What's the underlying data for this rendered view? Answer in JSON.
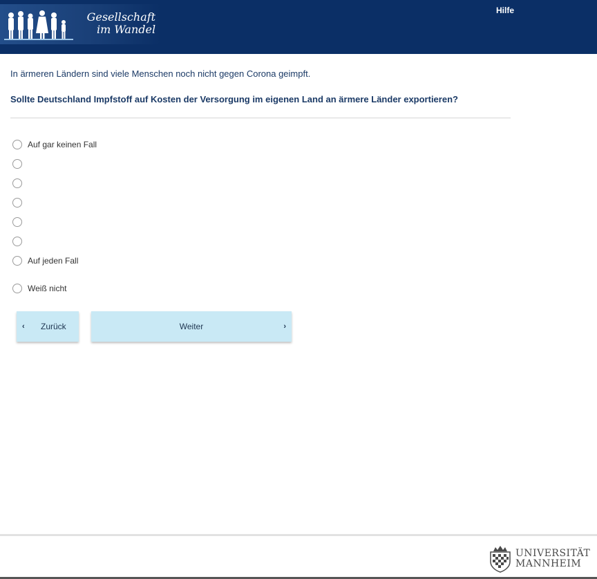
{
  "header": {
    "logo_line1": "Gesellschaft",
    "logo_line2": "im Wandel",
    "help_label": "Hilfe",
    "background_color": "#0b2f66"
  },
  "survey": {
    "intro": "In ärmeren Ländern sind viele Menschen noch nicht gegen Corona geimpft.",
    "question": "Sollte Deutschland Impfstoff auf Kosten der Versorgung im eigenen Land an ärmere Länder exportieren?",
    "options": [
      {
        "label": "Auf gar keinen Fall"
      },
      {
        "label": ""
      },
      {
        "label": ""
      },
      {
        "label": ""
      },
      {
        "label": ""
      },
      {
        "label": ""
      },
      {
        "label": "Auf jeden Fall"
      },
      {
        "label": "Weiß nicht"
      }
    ]
  },
  "nav": {
    "back_label": "Zurück",
    "next_label": "Weiter",
    "button_color": "#c9e9f5"
  },
  "footer": {
    "uni_line1": "UNIVERSITÄT",
    "uni_line2": "MANNHEIM"
  }
}
